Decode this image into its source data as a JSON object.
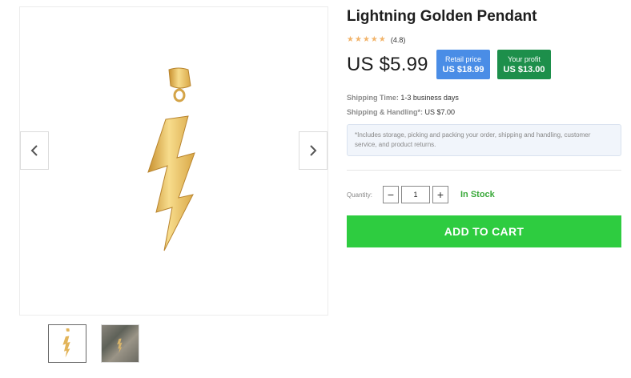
{
  "product": {
    "title": "Lightning Golden Pendant",
    "rating": "(4.8)",
    "rating_stars": 5,
    "price": "US $5.99",
    "retail_label": "Retail price",
    "retail_value": "US $18.99",
    "profit_label": "Your profit",
    "profit_value": "US $13.00"
  },
  "shipping": {
    "time_label": "Shipping Time:",
    "time_value": "1-3 business days",
    "handling_label": "Shipping & Handling*:",
    "handling_value": "US $7.00",
    "note": "*Includes storage, picking and packing your order, shipping and handling, customer service, and product returns."
  },
  "quantity": {
    "label": "Quantity:",
    "value": "1",
    "minus": "−",
    "plus": "+"
  },
  "stock_status": "In Stock",
  "add_to_cart_label": "ADD TO CART",
  "gallery": {
    "prev_icon": "chevron-left-icon",
    "next_icon": "chevron-right-icon",
    "thumbnail_count": 2
  },
  "colors": {
    "retail_badge": "#4a8de6",
    "profit_badge": "#1d8f4b",
    "cart_button": "#2ecc40",
    "in_stock": "#3aa93a",
    "stars": "#f2b46b",
    "gold": "#e2b45a"
  }
}
